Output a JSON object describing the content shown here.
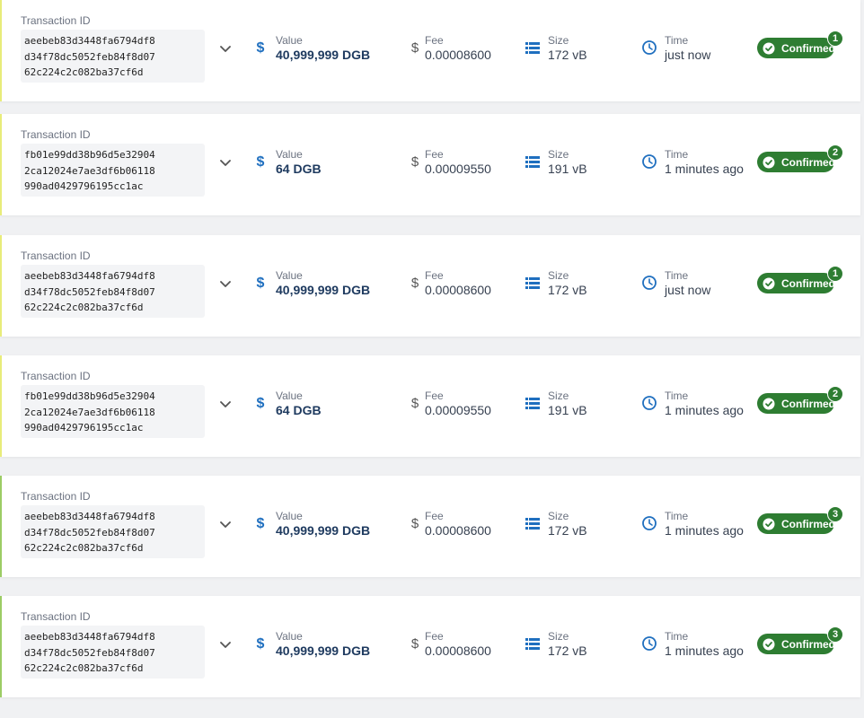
{
  "labels": {
    "transaction_id": "Transaction ID",
    "value": "Value",
    "fee": "Fee",
    "size": "Size",
    "time": "Time",
    "status": "Confirmed"
  },
  "colors": {
    "confirmed_badge": "#2e7d32",
    "value_text": "#1e3a5f",
    "icon_blue": "#1f6fbf",
    "accent_yellow": "#e8ec7a",
    "accent_green": "#9ccc65"
  },
  "icons": {
    "expand": "chevron-down-icon",
    "value": "dollar-icon",
    "fee": "dollar-icon",
    "size": "list-icon",
    "time": "clock-icon",
    "status": "check-circle-icon"
  },
  "transactions": [
    {
      "id": "aeebeb83d3448fa6794df8d34f78dc5052feb84f8d0762c224c2c082ba37cf6d",
      "value": "40,999,999 DGB",
      "fee": "0.00008600",
      "size": "172 vB",
      "time": "just now",
      "status": "Confirmed",
      "confirmations": "1",
      "accent": "#e8ec7a"
    },
    {
      "id": "fb01e99dd38b96d5e329042ca12024e7ae3df6b06118990ad0429796195cc1ac",
      "value": "64 DGB",
      "fee": "0.00009550",
      "size": "191 vB",
      "time": "1 minutes ago",
      "status": "Confirmed",
      "confirmations": "2",
      "accent": "#e8ec7a"
    },
    {
      "id": "aeebeb83d3448fa6794df8d34f78dc5052feb84f8d0762c224c2c082ba37cf6d",
      "value": "40,999,999 DGB",
      "fee": "0.00008600",
      "size": "172 vB",
      "time": "just now",
      "status": "Confirmed",
      "confirmations": "1",
      "accent": "#e8ec7a"
    },
    {
      "id": "fb01e99dd38b96d5e329042ca12024e7ae3df6b06118990ad0429796195cc1ac",
      "value": "64 DGB",
      "fee": "0.00009550",
      "size": "191 vB",
      "time": "1 minutes ago",
      "status": "Confirmed",
      "confirmations": "2",
      "accent": "#e8ec7a"
    },
    {
      "id": "aeebeb83d3448fa6794df8d34f78dc5052feb84f8d0762c224c2c082ba37cf6d",
      "value": "40,999,999 DGB",
      "fee": "0.00008600",
      "size": "172 vB",
      "time": "1 minutes ago",
      "status": "Confirmed",
      "confirmations": "3",
      "accent": "#9ccc65"
    },
    {
      "id": "aeebeb83d3448fa6794df8d34f78dc5052feb84f8d0762c224c2c082ba37cf6d",
      "value": "40,999,999 DGB",
      "fee": "0.00008600",
      "size": "172 vB",
      "time": "1 minutes ago",
      "status": "Confirmed",
      "confirmations": "3",
      "accent": "#9ccc65"
    }
  ]
}
